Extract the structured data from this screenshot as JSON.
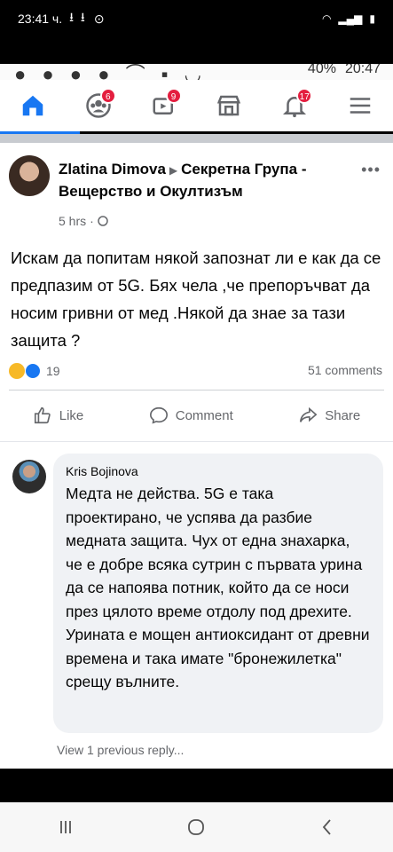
{
  "outer_status": {
    "time": "23:41 ч.",
    "download_icons": "⭳ ⭳",
    "extra_icon": "⊙"
  },
  "inner_status": {
    "battery": "40%",
    "time": "20:47"
  },
  "tabs": [
    {
      "name": "home",
      "badge": ""
    },
    {
      "name": "groups",
      "badge": "6"
    },
    {
      "name": "watch",
      "badge": "9"
    },
    {
      "name": "marketplace",
      "badge": ""
    },
    {
      "name": "notifications",
      "badge": "17"
    },
    {
      "name": "menu",
      "badge": ""
    }
  ],
  "post": {
    "author": "Zlatina Dimova",
    "group": "Секретна Група - Вещерство и Окултизъм",
    "time": "5 hrs",
    "text": "Искам да попитам някой запознат ли е как да се предпазим от 5G. Бях чела ,че препоръчват да носим гривни от мед .Някой да знае за тази защита ?",
    "reaction_count": "19",
    "comments_count": "51 comments"
  },
  "actions": {
    "like": "Like",
    "comment": "Comment",
    "share": "Share"
  },
  "comment": {
    "author": "Kris Bojinova",
    "text": "Медта не действа. 5G е така проектирано, че успява да разбие медната защита. Чух от една знахарка, че е добре всяка сутрин с първата урина да се напоява потник, който да се носи през цялото време отдолу под дрехите. Урината е мощен антиоксидант от древни времена и така имате \"бронежилетка\" срещу вълните.",
    "view_previous": "View 1 previous reply..."
  },
  "colors": {
    "accent": "#1877f2",
    "badge": "#e41e3f",
    "bubble": "#f0f2f5"
  }
}
